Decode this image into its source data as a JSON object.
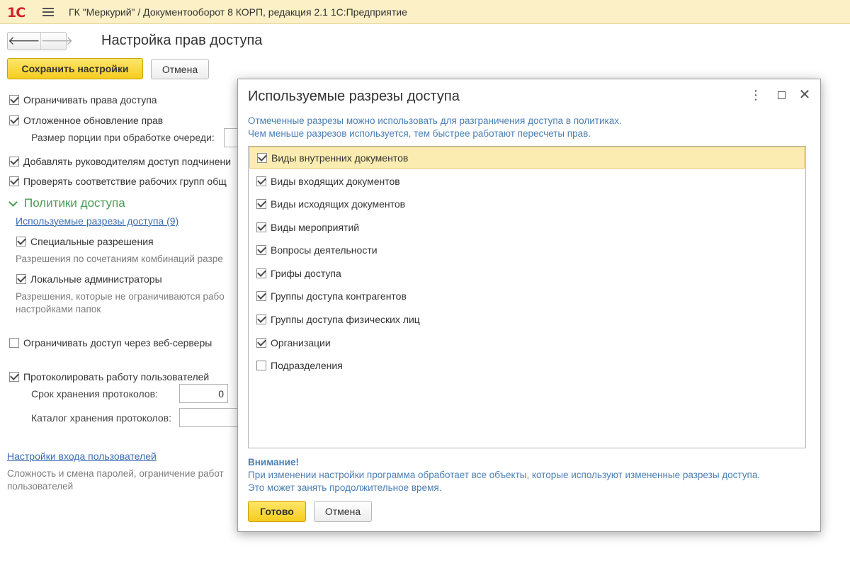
{
  "app": {
    "logo": "1С",
    "title": "ГК \"Меркурий\" / Документооборот 8 КОРП, редакция 2.1 1С:Предприятие"
  },
  "form": {
    "title": "Настройка прав доступа",
    "nav": {
      "back": "🡐",
      "forward": "🡒"
    },
    "buttons": {
      "save": "Сохранить настройки",
      "cancel": "Отмена"
    },
    "restrict_access": {
      "label": "Ограничивать права доступа",
      "checked": true
    },
    "deferred_update": {
      "label": "Отложенное обновление прав",
      "checked": true
    },
    "queue_portion_label": "Размер порции при обработке очереди:",
    "add_managers": {
      "label": "Добавлять руководителям доступ подчинени",
      "checked": true
    },
    "check_workgroups": {
      "label": "Проверять соответствие рабочих групп общ",
      "checked": true
    },
    "policies_section": "Политики доступа",
    "used_sections_link": "Используемые разрезы доступа (9)",
    "special_permissions": {
      "label": "Специальные разрешения",
      "checked": true
    },
    "special_permissions_hint": "Разрешения по сочетаниям комбинаций разре",
    "local_admins": {
      "label": "Локальные администраторы",
      "checked": true
    },
    "local_admins_hint_1": "Разрешения, которые не ограничиваются рабо",
    "local_admins_hint_2": "настройками папок",
    "restrict_web": {
      "label": "Ограничивать доступ через веб-серверы",
      "checked": false
    },
    "log_users": {
      "label": "Протоколировать работу пользователей",
      "checked": true
    },
    "log_retention_label": "Срок хранения протоколов:",
    "log_retention_value": "0",
    "log_catalog_label": "Каталог хранения протоколов:",
    "log_catalog_value": "",
    "login_settings_link": "Настройки входа пользователей",
    "login_settings_hint_1": "Сложность и смена паролей, ограничение работ",
    "login_settings_hint_2": "пользователей"
  },
  "dialog": {
    "title": "Используемые разрезы доступа",
    "description_1": "Отмеченные разрезы можно использовать для разграничения доступа в политиках.",
    "description_2": "Чем меньше разрезов используется, тем быстрее работают пересчеты прав.",
    "icons": {
      "more": "⋮",
      "close": "✕"
    },
    "items": [
      {
        "label": "Виды внутренних документов",
        "checked": true,
        "selected": true
      },
      {
        "label": "Виды входящих документов",
        "checked": true,
        "selected": false
      },
      {
        "label": "Виды исходящих документов",
        "checked": true,
        "selected": false
      },
      {
        "label": "Виды мероприятий",
        "checked": true,
        "selected": false
      },
      {
        "label": "Вопросы деятельности",
        "checked": true,
        "selected": false
      },
      {
        "label": "Грифы доступа",
        "checked": true,
        "selected": false
      },
      {
        "label": "Группы доступа контрагентов",
        "checked": true,
        "selected": false
      },
      {
        "label": "Группы доступа физических лиц",
        "checked": true,
        "selected": false
      },
      {
        "label": "Организации",
        "checked": true,
        "selected": false
      },
      {
        "label": "Подразделения",
        "checked": false,
        "selected": false
      }
    ],
    "warning_title": "Внимание!",
    "warning_1": "При изменении настройки программа обработает все объекты, которые используют измененные разрезы доступа.",
    "warning_2": "Это может занять продолжительное время.",
    "buttons": {
      "ok": "Готово",
      "cancel": "Отмена"
    }
  }
}
